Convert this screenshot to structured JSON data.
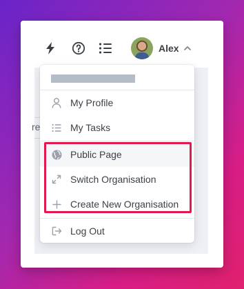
{
  "header": {
    "user_name": "Alex",
    "icons": [
      "lightning-icon",
      "help-icon",
      "list-icon",
      "chevron-up-icon"
    ]
  },
  "background": {
    "partial_text": "re"
  },
  "menu": {
    "items": [
      {
        "label": "My Profile",
        "icon": "user-icon"
      },
      {
        "label": "My Tasks",
        "icon": "list-icon"
      },
      {
        "label": "Public Page",
        "icon": "globe-icon"
      },
      {
        "label": "Switch Organisation",
        "icon": "expand-arrows-icon"
      },
      {
        "label": "Create New Organisation",
        "icon": "plus-icon"
      },
      {
        "label": "Log Out",
        "icon": "logout-icon"
      }
    ]
  },
  "colors": {
    "highlight_border": "#e2194f",
    "icon_gray": "#9aa1ab",
    "text": "#3b4048"
  }
}
